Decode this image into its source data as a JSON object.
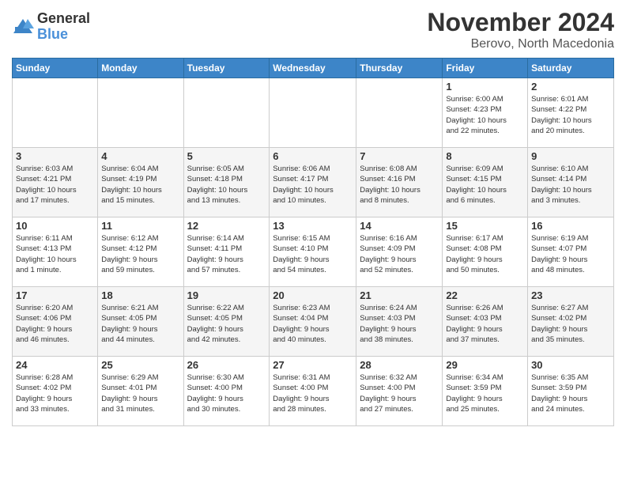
{
  "header": {
    "logo_general": "General",
    "logo_blue": "Blue",
    "month_title": "November 2024",
    "location": "Berovo, North Macedonia"
  },
  "weekdays": [
    "Sunday",
    "Monday",
    "Tuesday",
    "Wednesday",
    "Thursday",
    "Friday",
    "Saturday"
  ],
  "weeks": [
    [
      {
        "day": "",
        "info": ""
      },
      {
        "day": "",
        "info": ""
      },
      {
        "day": "",
        "info": ""
      },
      {
        "day": "",
        "info": ""
      },
      {
        "day": "",
        "info": ""
      },
      {
        "day": "1",
        "info": "Sunrise: 6:00 AM\nSunset: 4:23 PM\nDaylight: 10 hours\nand 22 minutes."
      },
      {
        "day": "2",
        "info": "Sunrise: 6:01 AM\nSunset: 4:22 PM\nDaylight: 10 hours\nand 20 minutes."
      }
    ],
    [
      {
        "day": "3",
        "info": "Sunrise: 6:03 AM\nSunset: 4:21 PM\nDaylight: 10 hours\nand 17 minutes."
      },
      {
        "day": "4",
        "info": "Sunrise: 6:04 AM\nSunset: 4:19 PM\nDaylight: 10 hours\nand 15 minutes."
      },
      {
        "day": "5",
        "info": "Sunrise: 6:05 AM\nSunset: 4:18 PM\nDaylight: 10 hours\nand 13 minutes."
      },
      {
        "day": "6",
        "info": "Sunrise: 6:06 AM\nSunset: 4:17 PM\nDaylight: 10 hours\nand 10 minutes."
      },
      {
        "day": "7",
        "info": "Sunrise: 6:08 AM\nSunset: 4:16 PM\nDaylight: 10 hours\nand 8 minutes."
      },
      {
        "day": "8",
        "info": "Sunrise: 6:09 AM\nSunset: 4:15 PM\nDaylight: 10 hours\nand 6 minutes."
      },
      {
        "day": "9",
        "info": "Sunrise: 6:10 AM\nSunset: 4:14 PM\nDaylight: 10 hours\nand 3 minutes."
      }
    ],
    [
      {
        "day": "10",
        "info": "Sunrise: 6:11 AM\nSunset: 4:13 PM\nDaylight: 10 hours\nand 1 minute."
      },
      {
        "day": "11",
        "info": "Sunrise: 6:12 AM\nSunset: 4:12 PM\nDaylight: 9 hours\nand 59 minutes."
      },
      {
        "day": "12",
        "info": "Sunrise: 6:14 AM\nSunset: 4:11 PM\nDaylight: 9 hours\nand 57 minutes."
      },
      {
        "day": "13",
        "info": "Sunrise: 6:15 AM\nSunset: 4:10 PM\nDaylight: 9 hours\nand 54 minutes."
      },
      {
        "day": "14",
        "info": "Sunrise: 6:16 AM\nSunset: 4:09 PM\nDaylight: 9 hours\nand 52 minutes."
      },
      {
        "day": "15",
        "info": "Sunrise: 6:17 AM\nSunset: 4:08 PM\nDaylight: 9 hours\nand 50 minutes."
      },
      {
        "day": "16",
        "info": "Sunrise: 6:19 AM\nSunset: 4:07 PM\nDaylight: 9 hours\nand 48 minutes."
      }
    ],
    [
      {
        "day": "17",
        "info": "Sunrise: 6:20 AM\nSunset: 4:06 PM\nDaylight: 9 hours\nand 46 minutes."
      },
      {
        "day": "18",
        "info": "Sunrise: 6:21 AM\nSunset: 4:05 PM\nDaylight: 9 hours\nand 44 minutes."
      },
      {
        "day": "19",
        "info": "Sunrise: 6:22 AM\nSunset: 4:05 PM\nDaylight: 9 hours\nand 42 minutes."
      },
      {
        "day": "20",
        "info": "Sunrise: 6:23 AM\nSunset: 4:04 PM\nDaylight: 9 hours\nand 40 minutes."
      },
      {
        "day": "21",
        "info": "Sunrise: 6:24 AM\nSunset: 4:03 PM\nDaylight: 9 hours\nand 38 minutes."
      },
      {
        "day": "22",
        "info": "Sunrise: 6:26 AM\nSunset: 4:03 PM\nDaylight: 9 hours\nand 37 minutes."
      },
      {
        "day": "23",
        "info": "Sunrise: 6:27 AM\nSunset: 4:02 PM\nDaylight: 9 hours\nand 35 minutes."
      }
    ],
    [
      {
        "day": "24",
        "info": "Sunrise: 6:28 AM\nSunset: 4:02 PM\nDaylight: 9 hours\nand 33 minutes."
      },
      {
        "day": "25",
        "info": "Sunrise: 6:29 AM\nSunset: 4:01 PM\nDaylight: 9 hours\nand 31 minutes."
      },
      {
        "day": "26",
        "info": "Sunrise: 6:30 AM\nSunset: 4:00 PM\nDaylight: 9 hours\nand 30 minutes."
      },
      {
        "day": "27",
        "info": "Sunrise: 6:31 AM\nSunset: 4:00 PM\nDaylight: 9 hours\nand 28 minutes."
      },
      {
        "day": "28",
        "info": "Sunrise: 6:32 AM\nSunset: 4:00 PM\nDaylight: 9 hours\nand 27 minutes."
      },
      {
        "day": "29",
        "info": "Sunrise: 6:34 AM\nSunset: 3:59 PM\nDaylight: 9 hours\nand 25 minutes."
      },
      {
        "day": "30",
        "info": "Sunrise: 6:35 AM\nSunset: 3:59 PM\nDaylight: 9 hours\nand 24 minutes."
      }
    ]
  ]
}
